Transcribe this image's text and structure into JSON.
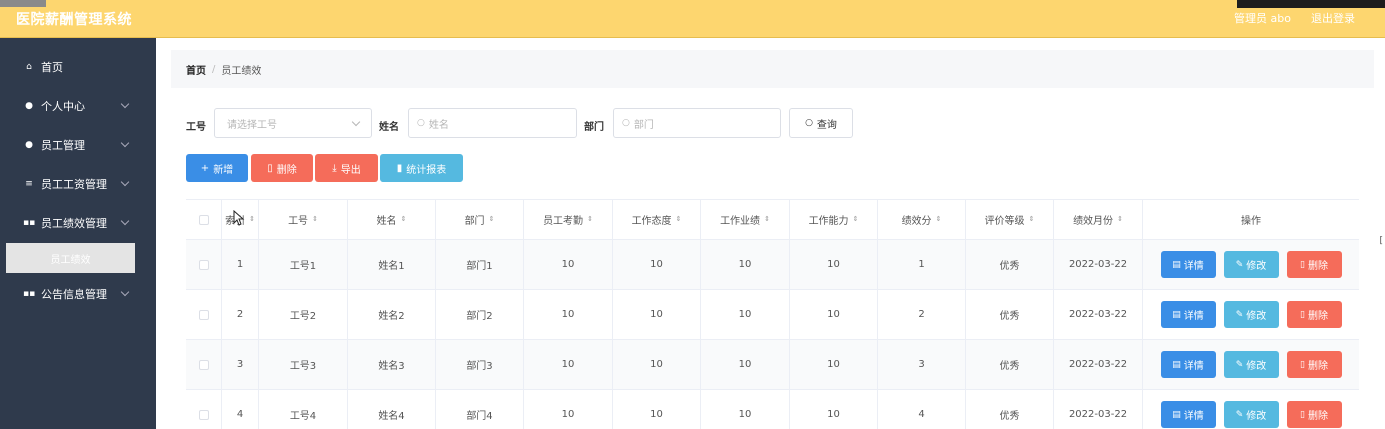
{
  "header": {
    "title": "医院薪酬管理系统",
    "user": "管理员 abo",
    "logout": "退出登录"
  },
  "sidebar": {
    "items": [
      {
        "label": "首页",
        "icon": "home-icon",
        "glyph": "⌂"
      },
      {
        "label": "个人中心",
        "icon": "user-icon",
        "glyph": "●"
      },
      {
        "label": "员工管理",
        "icon": "location-icon",
        "glyph": "●"
      },
      {
        "label": "员工工资管理",
        "icon": "menu-icon",
        "glyph": "≡"
      },
      {
        "label": "员工绩效管理",
        "icon": "grid-icon",
        "glyph": "▪▪"
      },
      {
        "label": "公告信息管理",
        "icon": "grid-icon",
        "glyph": "▪▪"
      }
    ],
    "sub_active": "员工绩效"
  },
  "breadcrumb": {
    "home": "首页",
    "separator": "/",
    "current": "员工绩效"
  },
  "search": {
    "gonghao_label": "工号",
    "gonghao_placeholder": "请选择工号",
    "name_label": "姓名",
    "name_placeholder": "姓名",
    "dept_label": "部门",
    "dept_placeholder": "部门",
    "query_button": "查询"
  },
  "toolbar": {
    "add": "新增",
    "delete": "删除",
    "export": "导出",
    "report": "统计报表"
  },
  "colors": {
    "header": "#fdd66f",
    "sidebar": "#2f3a4c",
    "primary": "#3a8ee6",
    "danger": "#f56c5a",
    "info": "#55b9e0"
  },
  "table": {
    "columns": [
      "索引",
      "工号",
      "姓名",
      "部门",
      "员工考勤",
      "工作态度",
      "工作业绩",
      "工作能力",
      "绩效分",
      "评价等级",
      "绩效月份",
      "操作"
    ],
    "rows": [
      {
        "index": "1",
        "gonghao": "工号1",
        "name": "姓名1",
        "dept": "部门1",
        "attendance": "10",
        "attitude": "10",
        "performance": "10",
        "ability": "10",
        "score": "1",
        "grade": "优秀",
        "month": "2022-03-22"
      },
      {
        "index": "2",
        "gonghao": "工号2",
        "name": "姓名2",
        "dept": "部门2",
        "attendance": "10",
        "attitude": "10",
        "performance": "10",
        "ability": "10",
        "score": "2",
        "grade": "优秀",
        "month": "2022-03-22"
      },
      {
        "index": "3",
        "gonghao": "工号3",
        "name": "姓名3",
        "dept": "部门3",
        "attendance": "10",
        "attitude": "10",
        "performance": "10",
        "ability": "10",
        "score": "3",
        "grade": "优秀",
        "month": "2022-03-22"
      },
      {
        "index": "4",
        "gonghao": "工号4",
        "name": "姓名4",
        "dept": "部门4",
        "attendance": "10",
        "attitude": "10",
        "performance": "10",
        "ability": "10",
        "score": "4",
        "grade": "优秀",
        "month": "2022-03-22"
      }
    ],
    "actions": {
      "detail": "详情",
      "edit": "修改",
      "delete": "删除"
    }
  }
}
